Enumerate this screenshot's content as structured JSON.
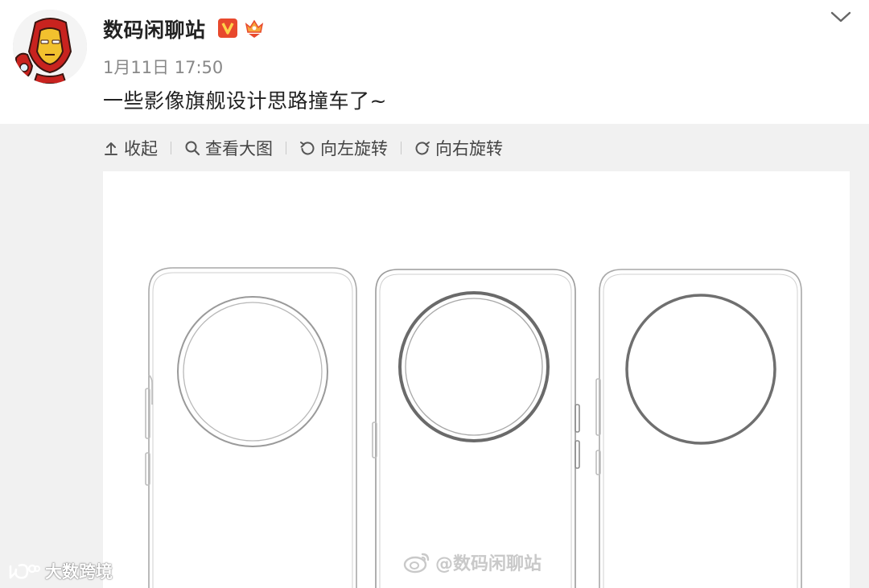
{
  "post": {
    "author": "数码闲聊站",
    "time": "1月11日 17:50",
    "text": "一些影像旗舰设计思路撞车了~",
    "badges": {
      "verified": {
        "icon": "verified-v-badge-icon",
        "label": "V",
        "color": "#e8492d"
      },
      "vip": {
        "icon": "vip-crown-badge-icon",
        "color": "#f6a53a"
      }
    },
    "menu_icon": "chevron-down-icon"
  },
  "toolbar": {
    "collapse": {
      "label": "收起",
      "icon": "collapse-up-icon"
    },
    "view_large": {
      "label": "查看大图",
      "icon": "search-icon"
    },
    "rotate_left": {
      "label": "向左旋转",
      "icon": "rotate-left-icon"
    },
    "rotate_right": {
      "label": "向右旋转",
      "icon": "rotate-right-icon"
    }
  },
  "image": {
    "watermark": "@数码闲聊站",
    "subject": "phone-back-sketches"
  },
  "corner_logo": {
    "text": "大数跨境"
  },
  "colors": {
    "media_background": "#f1f1f1",
    "text_primary": "#222222",
    "text_secondary": "#888888"
  }
}
